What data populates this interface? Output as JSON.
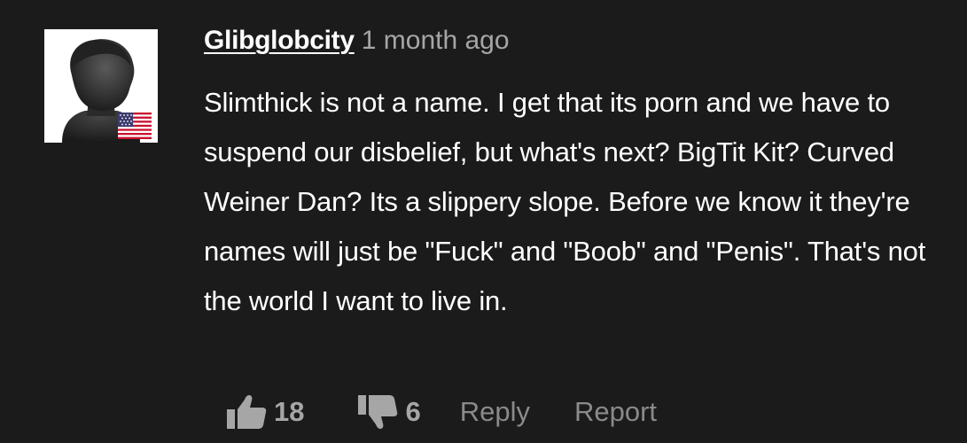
{
  "comment": {
    "username": "Glibglobcity",
    "timestamp": "1 month ago",
    "country_flag": "united-states-flag-icon",
    "avatar_icon": "default-user-silhouette-icon",
    "text": "Slimthick is not a name. I get that its porn and we have to suspend our disbelief, but what's next? BigTit Kit? Curved Weiner Dan? Its a slippery slope. Before we know it they're names will just be \"Fuck\" and \"Boob\" and \"Penis\". That's not the world I want to live in.",
    "upvotes": "18",
    "downvotes": "6",
    "reply_label": "Reply",
    "report_label": "Report"
  },
  "colors": {
    "background": "#1b1b1b",
    "text": "#ffffff",
    "muted": "#a6a6a6",
    "action": "#8a8a8a"
  }
}
